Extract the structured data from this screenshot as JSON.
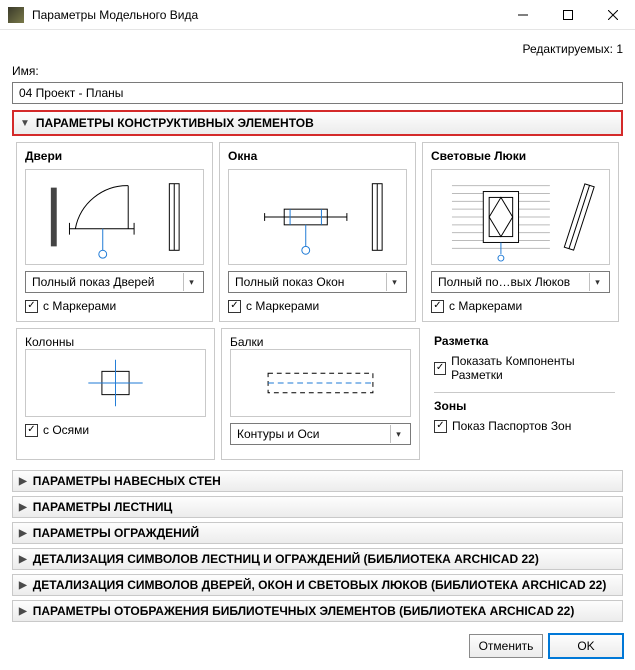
{
  "window": {
    "title": "Параметры Модельного Вида"
  },
  "editcount": "Редактируемых: 1",
  "name_label": "Имя:",
  "name_value": "04 Проект - Планы",
  "section_main": "ПАРАМЕТРЫ КОНСТРУКТИВНЫХ ЭЛЕМЕНТОВ",
  "doors": {
    "title": "Двери",
    "dropdown": "Полный показ Дверей",
    "marker": "с Маркерами"
  },
  "windows": {
    "title": "Окна",
    "dropdown": "Полный показ Окон",
    "marker": "с Маркерами"
  },
  "skylights": {
    "title": "Световые Люки",
    "dropdown": "Полный по…вых Люков",
    "marker": "с Маркерами"
  },
  "columns": {
    "title": "Колонны",
    "axes": "с Осями"
  },
  "beams": {
    "title": "Балки",
    "dropdown": "Контуры и Оси"
  },
  "markup": {
    "title": "Разметка",
    "show_components": "Показать Компоненты Разметки"
  },
  "zones": {
    "title": "Зоны",
    "show_passports": "Показ Паспортов Зон"
  },
  "collapsed": [
    "ПАРАМЕТРЫ НАВЕСНЫХ СТЕН",
    "ПАРАМЕТРЫ ЛЕСТНИЦ",
    "ПАРАМЕТРЫ ОГРАЖДЕНИЙ",
    "ДЕТАЛИЗАЦИЯ СИМВОЛОВ ЛЕСТНИЦ И ОГРАЖДЕНИЙ (БИБЛИОТЕКА ARCHICAD 22)",
    "ДЕТАЛИЗАЦИЯ СИМВОЛОВ ДВЕРЕЙ, ОКОН И СВЕТОВЫХ ЛЮКОВ (БИБЛИОТЕКА ARCHICAD 22)",
    "ПАРАМЕТРЫ ОТОБРАЖЕНИЯ БИБЛИОТЕЧНЫХ ЭЛЕМЕНТОВ (БИБЛИОТЕКА ARCHICAD 22)"
  ],
  "buttons": {
    "cancel": "Отменить",
    "ok": "OK"
  }
}
